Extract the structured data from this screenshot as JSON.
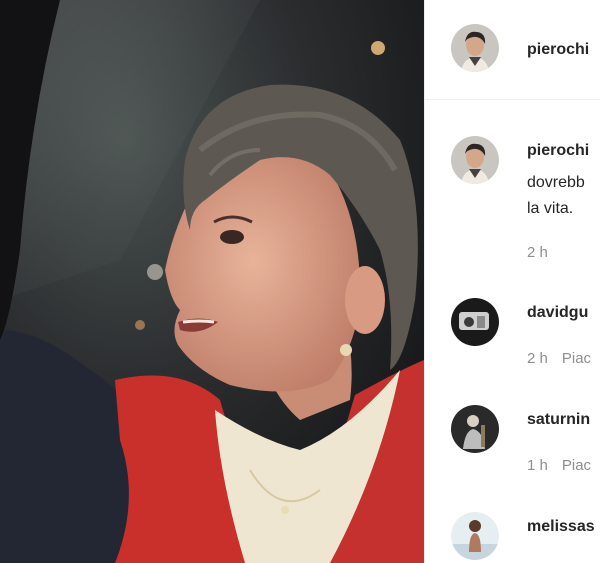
{
  "post": {
    "author": "pierochi",
    "caption_line1": "dovrebb",
    "caption_line2": "la vita.",
    "caption_time": "2 h"
  },
  "comments": [
    {
      "username": "davidgu",
      "time": "2 h",
      "like_label": "Piac"
    },
    {
      "username": "saturnin",
      "time": "1 h",
      "like_label": "Piac"
    },
    {
      "username": "melissas"
    }
  ],
  "icons": [
    "author-avatar",
    "commenter-avatar"
  ],
  "colors": {
    "text": "#262626",
    "muted": "#8e8e8e",
    "divider": "#efefef",
    "jacket": "#c9302c"
  }
}
